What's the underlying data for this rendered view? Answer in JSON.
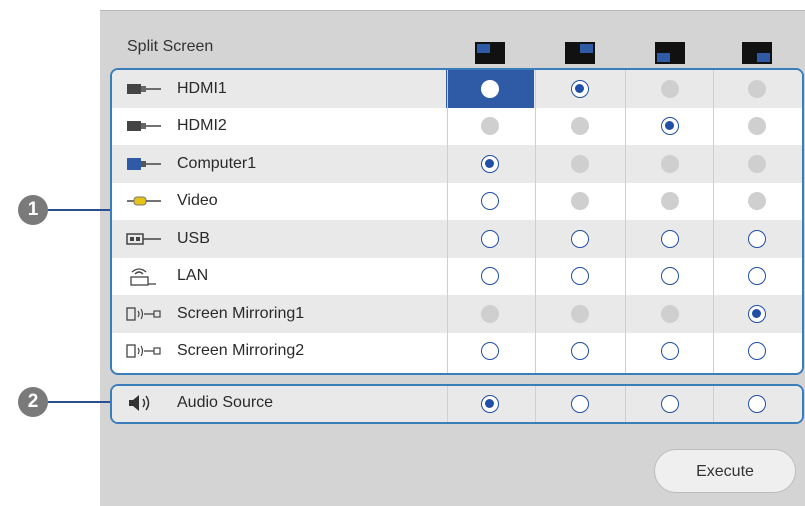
{
  "title": "Split Screen",
  "layouts": [
    {
      "icon": "layout-top-left-icon"
    },
    {
      "icon": "layout-top-right-icon"
    },
    {
      "icon": "layout-bottom-left-icon"
    },
    {
      "icon": "layout-bottom-right-icon"
    }
  ],
  "sources": [
    {
      "label": "HDMI1",
      "icon": "hdmi-icon",
      "states": [
        "focus",
        "checked",
        "disabled",
        "disabled"
      ]
    },
    {
      "label": "HDMI2",
      "icon": "hdmi-icon",
      "states": [
        "disabled",
        "disabled",
        "checked",
        "disabled"
      ]
    },
    {
      "label": "Computer1",
      "icon": "computer-icon",
      "states": [
        "checked",
        "disabled",
        "disabled",
        "disabled"
      ]
    },
    {
      "label": "Video",
      "icon": "video-icon",
      "states": [
        "empty",
        "disabled",
        "disabled",
        "disabled"
      ]
    },
    {
      "label": "USB",
      "icon": "usb-icon",
      "states": [
        "empty",
        "empty",
        "empty",
        "empty"
      ]
    },
    {
      "label": "LAN",
      "icon": "lan-icon",
      "states": [
        "empty",
        "empty",
        "empty",
        "empty"
      ]
    },
    {
      "label": "Screen Mirroring1",
      "icon": "screen-mirroring-icon",
      "states": [
        "disabled",
        "disabled",
        "disabled",
        "checked"
      ]
    },
    {
      "label": "Screen Mirroring2",
      "icon": "screen-mirroring-icon",
      "states": [
        "empty",
        "empty",
        "empty",
        "empty"
      ]
    }
  ],
  "audio": {
    "label": "Audio Source",
    "icon": "speaker-icon",
    "states": [
      "checked",
      "empty",
      "empty",
      "empty"
    ]
  },
  "callouts": [
    "1",
    "2"
  ],
  "execute_label": "Execute",
  "colors": {
    "accent": "#1f4fa6",
    "border": "#3a7dbb",
    "panel": "#d4d4d4"
  }
}
